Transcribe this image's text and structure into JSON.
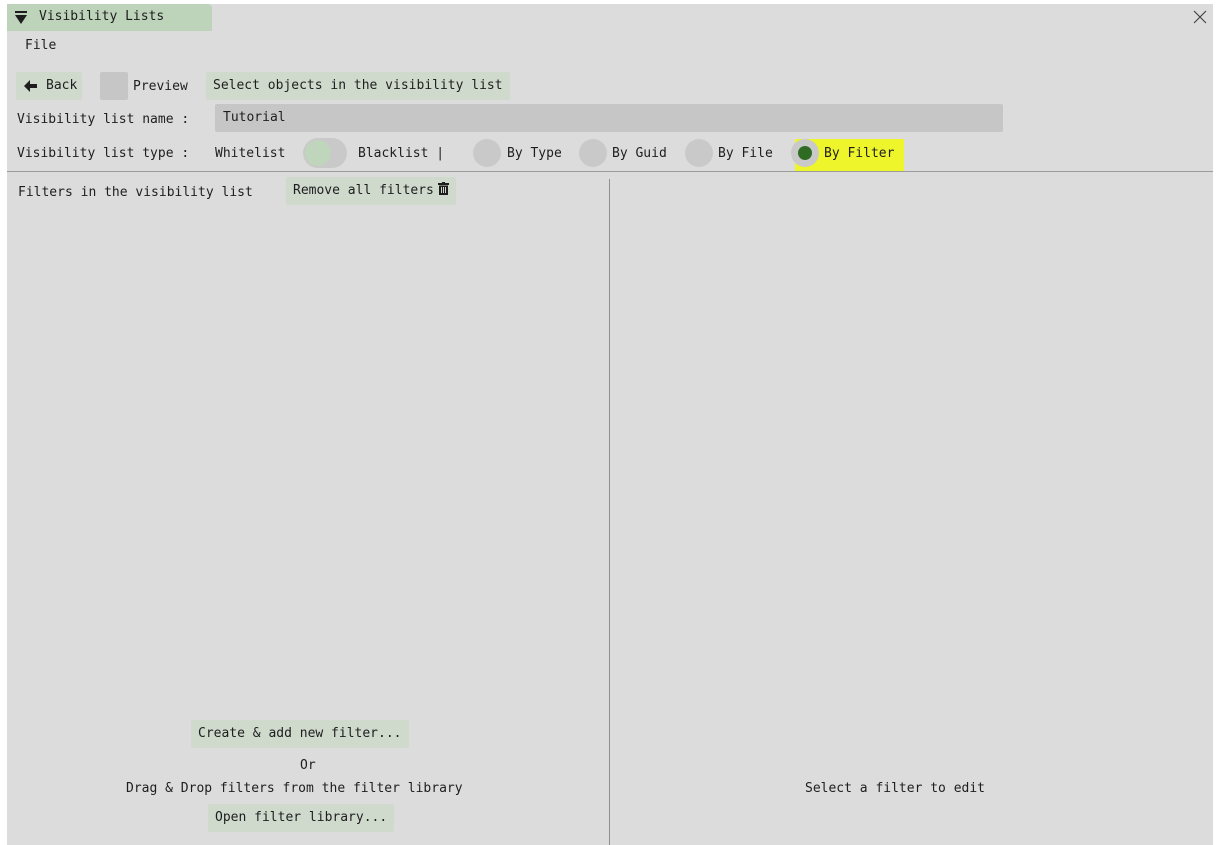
{
  "window": {
    "title": "Visibility Lists",
    "collapse_icon": "caret-down-icon",
    "close_icon": "close-icon"
  },
  "menu": {
    "file": "File"
  },
  "toolbar": {
    "back_label": "Back",
    "back_icon": "arrow-left-icon",
    "preview_label": "Preview",
    "preview_checked": false,
    "select_objects_label": "Select objects in the visibility list"
  },
  "name_row": {
    "label": "Visibility list name :",
    "value": "Tutorial"
  },
  "type_row": {
    "label": "Visibility list type :",
    "whitelist_label": "Whitelist",
    "blacklist_label": "Blacklist |",
    "toggle_state": "Whitelist",
    "options": [
      {
        "label": "By Type",
        "selected": false
      },
      {
        "label": "By Guid",
        "selected": false
      },
      {
        "label": "By File",
        "selected": false
      },
      {
        "label": "By Filter",
        "selected": true
      }
    ]
  },
  "left_panel": {
    "filters_label": "Filters in the visibility list",
    "remove_all_label": "Remove all filters",
    "remove_all_icon": "trash-icon",
    "create_button": "Create & add new filter...",
    "or_text": "Or",
    "drag_text": "Drag & Drop filters from the filter library",
    "open_library_button": "Open filter library..."
  },
  "right_panel": {
    "empty_text": "Select a filter to edit"
  },
  "colors": {
    "background": "#dcdcdc",
    "accent_green": "#cfdacd",
    "selected_dot": "#2f6b22",
    "highlight": "#eef52a"
  }
}
